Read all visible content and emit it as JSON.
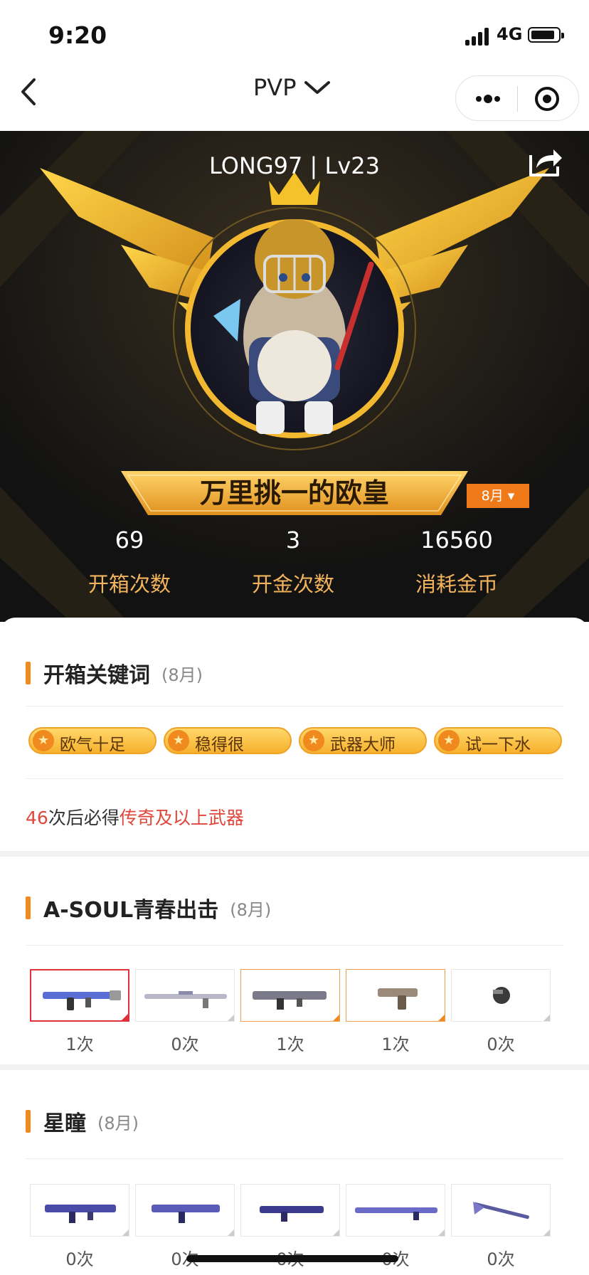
{
  "status_bar": {
    "time": "9:20",
    "network": "4G"
  },
  "nav": {
    "title": "PVP"
  },
  "hero": {
    "username": "LONG97 | Lv23",
    "title": "万里挑一的欧皇",
    "month_filter": "8月 ▾",
    "stats": [
      {
        "value": "69",
        "label": "开箱次数"
      },
      {
        "value": "3",
        "label": "开金次数"
      },
      {
        "value": "16560",
        "label": "消耗金币"
      }
    ]
  },
  "keywords": {
    "title": "开箱关键词",
    "month": "(8月)",
    "tags": [
      "欧气十足",
      "稳得很",
      "武器大师",
      "试一下水"
    ],
    "guarantee_count": "46",
    "guarantee_mid": "次后必得",
    "guarantee_item": "传奇及以上武器"
  },
  "collection1": {
    "title": "A-SOUL青春出击",
    "month": "(8月)",
    "items": [
      {
        "count": "1次",
        "color": "#5a6fd6"
      },
      {
        "count": "0次",
        "color": "#b8b8c8"
      },
      {
        "count": "1次",
        "color": "#7a7a8a"
      },
      {
        "count": "1次",
        "color": "#9a8a7a"
      },
      {
        "count": "0次",
        "color": "#3a3a3a"
      }
    ]
  },
  "collection2": {
    "title": "星瞳",
    "month": "(8月)",
    "items": [
      {
        "count": "0次",
        "color": "#4a4aa8"
      },
      {
        "count": "0次",
        "color": "#5a5ab8"
      },
      {
        "count": "0次",
        "color": "#3a3a90"
      },
      {
        "count": "0次",
        "color": "#6a6ac8"
      },
      {
        "count": "0次",
        "color": "#5a5aa0"
      }
    ]
  },
  "colors": {
    "accent": "#f08a1e",
    "red": "#e0463a",
    "gold": "#f2b35c"
  }
}
